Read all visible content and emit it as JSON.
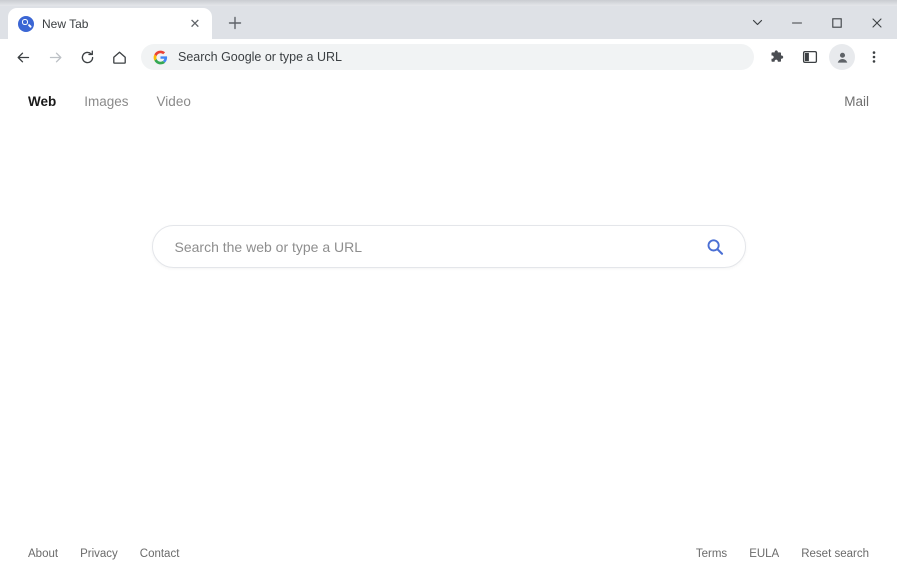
{
  "window": {
    "controls": [
      {
        "name": "tab-search",
        "glyph": "⌄"
      },
      {
        "name": "minimize",
        "glyph": "—"
      },
      {
        "name": "maximize",
        "glyph": "□"
      },
      {
        "name": "close",
        "glyph": "✕"
      }
    ]
  },
  "tabstrip": {
    "tab": {
      "title": "New Tab",
      "favicon": "search-circle-icon",
      "close_glyph": "✕"
    },
    "new_tab_glyph": "+"
  },
  "toolbar": {
    "back_glyph": "←",
    "forward_glyph": "→",
    "reload_glyph": "⟳",
    "home_glyph": "⌂",
    "omnibox": {
      "icon": "google-g-icon",
      "placeholder": "Search Google or type a URL",
      "value": ""
    },
    "extensions_icon": "puzzle-icon",
    "side_panel_icon": "side-panel-icon",
    "avatar_icon": "profile-avatar-icon",
    "menu_glyph": "⋮"
  },
  "page": {
    "nav": {
      "links": [
        {
          "label": "Web",
          "active": true
        },
        {
          "label": "Images",
          "active": false
        },
        {
          "label": "Video",
          "active": false
        }
      ],
      "mail_label": "Mail"
    },
    "search": {
      "placeholder": "Search the web or type a URL",
      "value": "",
      "icon": "search-magnifier-icon",
      "icon_color": "#4a6fd4"
    },
    "footer": {
      "left_links": [
        "About",
        "Privacy",
        "Contact"
      ],
      "right_links": [
        "Terms",
        "EULA",
        "Reset search"
      ]
    }
  },
  "background": {
    "top_ghost_text": "                                                                                                                                                    ",
    "accent_green": "#5ca033"
  }
}
